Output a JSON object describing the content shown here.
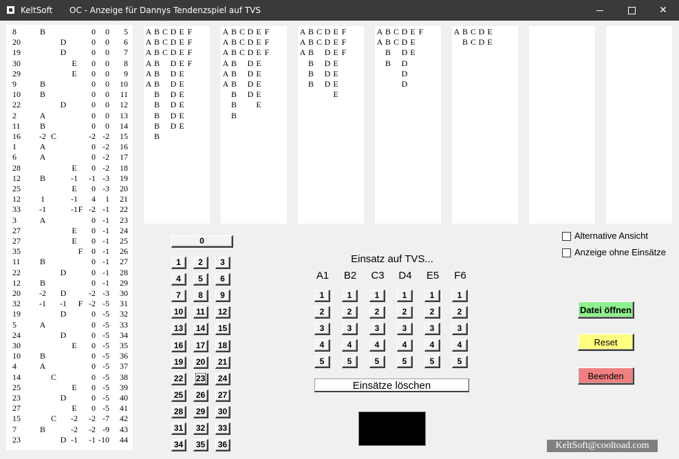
{
  "window": {
    "app_name": "KeltSoft",
    "title": "OC - Anzeige für Dannys Tendenzspiel auf TVS",
    "minimize": "—",
    "close": "✕"
  },
  "left_list": [
    [
      "8",
      "B",
      "",
      "",
      "",
      "",
      "",
      "0",
      "0",
      "5"
    ],
    [
      "20",
      "",
      "",
      "D",
      "",
      "",
      "",
      "0",
      "0",
      "6"
    ],
    [
      "19",
      "",
      "",
      "D",
      "",
      "",
      "",
      "0",
      "0",
      "7"
    ],
    [
      "30",
      "",
      "",
      "",
      "E",
      "",
      "",
      "0",
      "0",
      "8"
    ],
    [
      "29",
      "",
      "",
      "",
      "E",
      "",
      "",
      "0",
      "0",
      "9"
    ],
    [
      "9",
      "B",
      "",
      "",
      "",
      "",
      "",
      "0",
      "0",
      "10"
    ],
    [
      "10",
      "B",
      "",
      "",
      "",
      "",
      "",
      "0",
      "0",
      "11"
    ],
    [
      "22",
      "",
      "",
      "D",
      "",
      "",
      "",
      "0",
      "0",
      "12"
    ],
    [
      "2",
      "A",
      "",
      "",
      "",
      "",
      "",
      "0",
      "0",
      "13"
    ],
    [
      "11",
      "B",
      "",
      "",
      "",
      "",
      "",
      "0",
      "0",
      "14"
    ],
    [
      "16",
      "-2",
      "C",
      "",
      "",
      "",
      "",
      "-2",
      "-2",
      "15"
    ],
    [
      "1",
      "A",
      "",
      "",
      "",
      "",
      "",
      "0",
      "-2",
      "16"
    ],
    [
      "6",
      "A",
      "",
      "",
      "",
      "",
      "",
      "0",
      "-2",
      "17"
    ],
    [
      "28",
      "",
      "",
      "",
      "E",
      "",
      "",
      "0",
      "-2",
      "18"
    ],
    [
      "12",
      "B",
      "",
      "",
      "-1",
      "",
      "",
      "-1",
      "-3",
      "19"
    ],
    [
      "25",
      "",
      "",
      "",
      "E",
      "",
      "",
      "0",
      "-3",
      "20"
    ],
    [
      "12",
      "1",
      "",
      "",
      "-1",
      "",
      "",
      "4",
      "1",
      "21"
    ],
    [
      "33",
      "-1",
      "",
      "",
      "-1",
      "F",
      "",
      "-2",
      "-1",
      "22"
    ],
    [
      "3",
      "A",
      "",
      "",
      "",
      "",
      "",
      "0",
      "-1",
      "23"
    ],
    [
      "27",
      "",
      "",
      "",
      "E",
      "",
      "",
      "0",
      "-1",
      "24"
    ],
    [
      "27",
      "",
      "",
      "",
      "E",
      "",
      "",
      "0",
      "-1",
      "25"
    ],
    [
      "35",
      "",
      "",
      "",
      "",
      "F",
      "",
      "0",
      "-1",
      "26"
    ],
    [
      "11",
      "B",
      "",
      "",
      "",
      "",
      "",
      "0",
      "-1",
      "27"
    ],
    [
      "22",
      "",
      "",
      "D",
      "",
      "",
      "",
      "0",
      "-1",
      "28"
    ],
    [
      "12",
      "B",
      "",
      "",
      "",
      "",
      "",
      "0",
      "-1",
      "29"
    ],
    [
      "20",
      "-2",
      "",
      "D",
      "",
      "",
      "",
      "-2",
      "-3",
      "30"
    ],
    [
      "32",
      "-1",
      "",
      "-1",
      "",
      "F",
      "",
      "-2",
      "-5",
      "31"
    ],
    [
      "19",
      "",
      "",
      "D",
      "",
      "",
      "",
      "0",
      "-5",
      "32"
    ],
    [
      "5",
      "A",
      "",
      "",
      "",
      "",
      "",
      "0",
      "-5",
      "33"
    ],
    [
      "24",
      "",
      "",
      "D",
      "",
      "",
      "",
      "0",
      "-5",
      "34"
    ],
    [
      "30",
      "",
      "",
      "",
      "E",
      "",
      "",
      "0",
      "-5",
      "35"
    ],
    [
      "10",
      "B",
      "",
      "",
      "",
      "",
      "",
      "0",
      "-5",
      "36"
    ],
    [
      "4",
      "A",
      "",
      "",
      "",
      "",
      "",
      "0",
      "-5",
      "37"
    ],
    [
      "14",
      "",
      "C",
      "",
      "",
      "",
      "",
      "0",
      "-5",
      "38"
    ],
    [
      "25",
      "",
      "",
      "",
      "E",
      "",
      "",
      "0",
      "-5",
      "39"
    ],
    [
      "23",
      "",
      "",
      "D",
      "",
      "",
      "",
      "0",
      "-5",
      "40"
    ],
    [
      "27",
      "",
      "",
      "",
      "E",
      "",
      "",
      "0",
      "-5",
      "41"
    ],
    [
      "15",
      "",
      "C",
      "",
      "-2",
      "",
      "",
      "-2",
      "-7",
      "42"
    ],
    [
      "7",
      "B",
      "",
      "",
      "-2",
      "",
      "",
      "-2",
      "-9",
      "43"
    ],
    [
      "23",
      "",
      "",
      "D",
      "-1",
      "",
      "",
      "-1",
      "-10",
      "44"
    ]
  ],
  "tendency_columns": [
    [
      [
        "A",
        "B",
        "C",
        "D",
        "E",
        "F"
      ],
      [
        "A",
        "B",
        "C",
        "D",
        "E",
        "F"
      ],
      [
        "A",
        "B",
        "C",
        "D",
        "E",
        "F"
      ],
      [
        "A",
        "B",
        "",
        "D",
        "E",
        "F"
      ],
      [
        "A",
        "B",
        "",
        "D",
        "E",
        ""
      ],
      [
        "A",
        "B",
        "",
        "D",
        "E",
        ""
      ],
      [
        "",
        "B",
        "",
        "D",
        "E",
        ""
      ],
      [
        "",
        "B",
        "",
        "D",
        "E",
        ""
      ],
      [
        "",
        "B",
        "",
        "D",
        "E",
        ""
      ],
      [
        "",
        "B",
        "",
        "D",
        "E",
        ""
      ],
      [
        "",
        "B",
        "",
        "",
        "",
        ""
      ]
    ],
    [
      [
        "A",
        "B",
        "C",
        "D",
        "E",
        "F"
      ],
      [
        "A",
        "B",
        "C",
        "D",
        "E",
        "F"
      ],
      [
        "A",
        "B",
        "C",
        "D",
        "E",
        "F"
      ],
      [
        "A",
        "B",
        "",
        "D",
        "E",
        ""
      ],
      [
        "A",
        "B",
        "",
        "D",
        "E",
        ""
      ],
      [
        "A",
        "B",
        "",
        "D",
        "E",
        ""
      ],
      [
        "",
        "B",
        "",
        "D",
        "E",
        ""
      ],
      [
        "",
        "B",
        "",
        "",
        "E",
        ""
      ],
      [
        "",
        "B",
        "",
        "",
        "",
        ""
      ]
    ],
    [
      [
        "A",
        "B",
        "C",
        "D",
        "E",
        "F"
      ],
      [
        "A",
        "B",
        "C",
        "D",
        "E",
        "F"
      ],
      [
        "A",
        "B",
        "",
        "D",
        "E",
        "F"
      ],
      [
        "",
        "B",
        "",
        "D",
        "E",
        ""
      ],
      [
        "",
        "B",
        "",
        "D",
        "E",
        ""
      ],
      [
        "",
        "B",
        "",
        "D",
        "E",
        ""
      ],
      [
        "",
        "",
        "",
        "",
        "E",
        ""
      ]
    ],
    [
      [
        "A",
        "B",
        "C",
        "D",
        "E",
        "F"
      ],
      [
        "A",
        "B",
        "C",
        "D",
        "E",
        ""
      ],
      [
        "",
        "B",
        "",
        "D",
        "E",
        ""
      ],
      [
        "",
        "B",
        "",
        "D",
        "",
        ""
      ],
      [
        "",
        "",
        "",
        "D",
        "",
        ""
      ],
      [
        "",
        "",
        "",
        "D",
        "",
        ""
      ]
    ],
    [
      [
        "A",
        "B",
        "C",
        "D",
        "E",
        ""
      ],
      [
        "",
        "B",
        "C",
        "D",
        "E",
        ""
      ]
    ],
    [],
    []
  ],
  "numbers": {
    "zero": "0",
    "grid": [
      [
        "1",
        "2",
        "3"
      ],
      [
        "4",
        "5",
        "6"
      ],
      [
        "7",
        "8",
        "9"
      ],
      [
        "10",
        "11",
        "12"
      ],
      [
        "13",
        "14",
        "15"
      ],
      [
        "16",
        "17",
        "18"
      ],
      [
        "19",
        "20",
        "21"
      ],
      [
        "22",
        "23",
        "24"
      ],
      [
        "25",
        "26",
        "27"
      ],
      [
        "28",
        "29",
        "30"
      ],
      [
        "31",
        "32",
        "33"
      ],
      [
        "34",
        "35",
        "36"
      ]
    ]
  },
  "bet": {
    "title": "Einsatz auf TVS...",
    "headers": [
      "A1",
      "B2",
      "C3",
      "D4",
      "E5",
      "F6"
    ],
    "amounts": [
      "1",
      "2",
      "3",
      "4",
      "5"
    ],
    "clear_label": "Einsätze löschen"
  },
  "options": {
    "alt_view": "Alternative Ansicht",
    "no_bets": "Anzeige ohne Einsätze"
  },
  "actions": {
    "open": "Datei öffnen",
    "reset": "Reset",
    "quit": "Beenden"
  },
  "footer": "KeltSoft@cooltoad.com",
  "colors": {
    "titlebar": "#3a3a3a",
    "open_button": "#8ef08e",
    "reset_button": "#ffff80",
    "quit_button": "#f08080",
    "footer_bg": "#808080"
  }
}
